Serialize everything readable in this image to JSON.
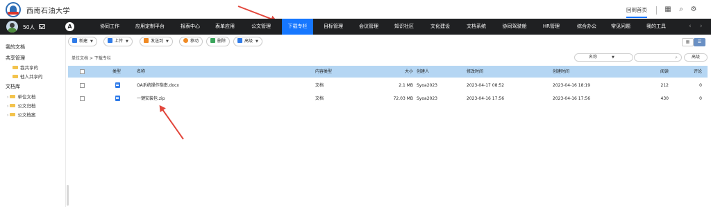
{
  "header": {
    "school_name": "西南石油大学",
    "home_link": "回到首页"
  },
  "user": {
    "count_label": "50人"
  },
  "nav": {
    "items": [
      "协同工作",
      "应用定制平台",
      "报表中心",
      "表单应用",
      "公文管理",
      "下载专栏",
      "目标管理",
      "会议管理",
      "知识社区",
      "文化建设",
      "文档系统",
      "协同驾驶舱",
      "HR管理",
      "综合办公",
      "常见问题",
      "我的工具"
    ],
    "active": "下载专栏"
  },
  "sidebar": {
    "my_docs": "我的文档",
    "shared": "共享管理",
    "shared_items": [
      "我共享的",
      "他人共享的"
    ],
    "library": "文档库",
    "library_items": [
      "单位文档",
      "公文归档",
      "公文档案"
    ]
  },
  "toolbar": {
    "new": "新建",
    "upload": "上传",
    "send": "发送到",
    "move": "移动",
    "delete": "删除",
    "advanced": "高级"
  },
  "breadcrumb": "单位文档 > 下载专栏",
  "sort": {
    "selected": "名称"
  },
  "advanced_search": "高级",
  "table": {
    "headers": {
      "type": "类型",
      "name": "名称",
      "content_type": "内容类型",
      "size": "大小",
      "creator": "创建人",
      "modified": "修改时间",
      "created": "创建时间",
      "views": "阅读",
      "comments": "评论"
    },
    "rows": [
      {
        "name": "OA系统操作指南.docx",
        "content_type": "文档",
        "size": "2.1 MB",
        "creator": "Syoa2023",
        "modified": "2023-04-17 08:52",
        "created": "2023-04-16 18:19",
        "views": "212",
        "comments": "0"
      },
      {
        "name": "一键安装包.zip",
        "content_type": "文档",
        "size": "72.03 MB",
        "creator": "Syoa2023",
        "modified": "2023-04-16 17:56",
        "created": "2023-04-16 17:56",
        "views": "430",
        "comments": "0"
      }
    ]
  },
  "colors": {
    "nav_bg": "#1f2022",
    "nav_active": "#1677ff",
    "table_header": "#b5d6f3",
    "annotation_arrow": "#e2473c"
  }
}
